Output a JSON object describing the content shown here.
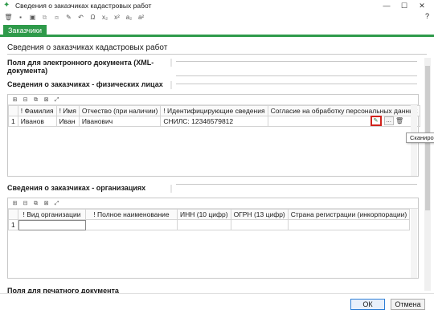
{
  "window": {
    "title": "Сведения о заказчиках кадастровых работ",
    "buttons": [
      "—",
      "☐",
      "✕"
    ]
  },
  "toolbar": {
    "help": "?"
  },
  "tab": {
    "label": "Заказчики"
  },
  "page": {
    "title": "Сведения о заказчиках кадастровых работ"
  },
  "sections": {
    "xml": "Поля для электронного документа (XML-документа)",
    "persons": "Сведения о заказчиках - физических лицах",
    "orgs": "Сведения о заказчиках - организациях",
    "print": "Поля для печатного документа"
  },
  "persons_table": {
    "columns": [
      "",
      "! Фамилия",
      "! Имя",
      "Отчество (при наличии)",
      "! Идентифицирующие сведения",
      "Согласие на обработку персональных данных"
    ],
    "rows": [
      {
        "num": "1",
        "surname": "Иванов",
        "name": "Иван",
        "patronymic": "Иванович",
        "id_info": "СНИЛС: 12346579812",
        "consent": ""
      }
    ]
  },
  "orgs_table": {
    "columns": [
      "",
      "! Вид организации",
      "! Полное наименование",
      "ИНН (10 цифр)",
      "ОГРН (13 цифр)",
      "Страна регистрации (инкорпорации)"
    ],
    "rows": [
      {
        "num": "1",
        "cells": [
          "",
          "",
          "",
          "",
          ""
        ]
      }
    ]
  },
  "tooltip": {
    "text": "Сканировать"
  },
  "footer": {
    "ok": "ОК",
    "cancel": "Отмена"
  },
  "colors": {
    "accent": "#2e9a4a",
    "highlight": "#d0231c"
  }
}
